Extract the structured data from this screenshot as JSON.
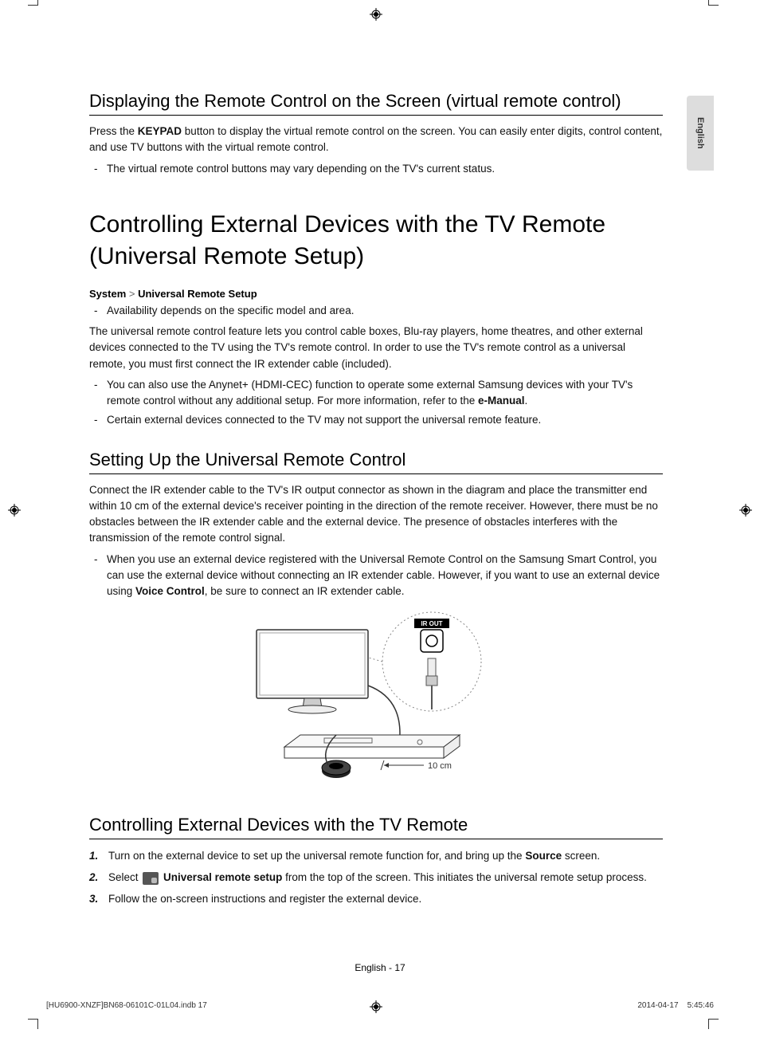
{
  "langTab": "English",
  "section1": {
    "title": "Displaying the Remote Control on the Screen (virtual remote control)",
    "p1a": "Press the ",
    "p1b": "KEYPAD",
    "p1c": " button to display the virtual remote control on the screen. You can easily enter digits, control content, and use TV buttons with the virtual remote control.",
    "bullet1": "The virtual remote control buttons may vary depending on the TV's current status."
  },
  "chapter": "Controlling External Devices with the TV Remote (Universal Remote Setup)",
  "breadcrumb": {
    "a": "System",
    "sep": ">",
    "b": "Universal Remote Setup"
  },
  "avail": "Availability depends on the specific model and area.",
  "intro": "The universal remote control feature lets you control cable boxes, Blu-ray players, home theatres, and other external devices connected to the TV using the TV's remote control. In order to use the TV's remote control as a universal remote, you must first connect the IR extender cable (included).",
  "bullets2": {
    "a1": "You can also use the Anynet+ (HDMI-CEC) function to operate some external Samsung devices with your TV's remote control without any additional setup. For more information, refer to the ",
    "a2": "e-Manual",
    "a3": ".",
    "b": "Certain external devices connected to the TV may not support the universal remote feature."
  },
  "section2": {
    "title": "Setting Up the Universal Remote Control",
    "p": "Connect the IR extender cable to the TV's IR output connector as shown in the diagram and place the transmitter end within 10 cm of the external device's receiver pointing in the direction of the remote receiver. However, there must be no obstacles between the IR extender cable and the external device. The presence of obstacles interferes with the transmission of the remote control signal.",
    "bullet_a": "When you use an external device registered with the Universal Remote Control on the Samsung Smart Control, you can use the external device without connecting an IR extender cable. However, if you want to use an external device using ",
    "bullet_b": "Voice Control",
    "bullet_c": ", be sure to connect an IR extender cable."
  },
  "diagram": {
    "irout": "IR OUT",
    "dist": "10 cm"
  },
  "section3": {
    "title": "Controlling External Devices with the TV Remote",
    "steps": {
      "s1a": "Turn on the external device to set up the universal remote function for, and bring up the ",
      "s1b": "Source",
      "s1c": " screen.",
      "s2a": "Select ",
      "s2b": "Universal remote setup",
      "s2c": " from the top of the screen. This initiates the universal remote setup process.",
      "s3": "Follow the on-screen instructions and register the external device."
    }
  },
  "footer": {
    "page": "English - 17",
    "left": "[HU6900-XNZF]BN68-06101C-01L04.indb   17",
    "right": "2014-04-17      5:45:46"
  }
}
